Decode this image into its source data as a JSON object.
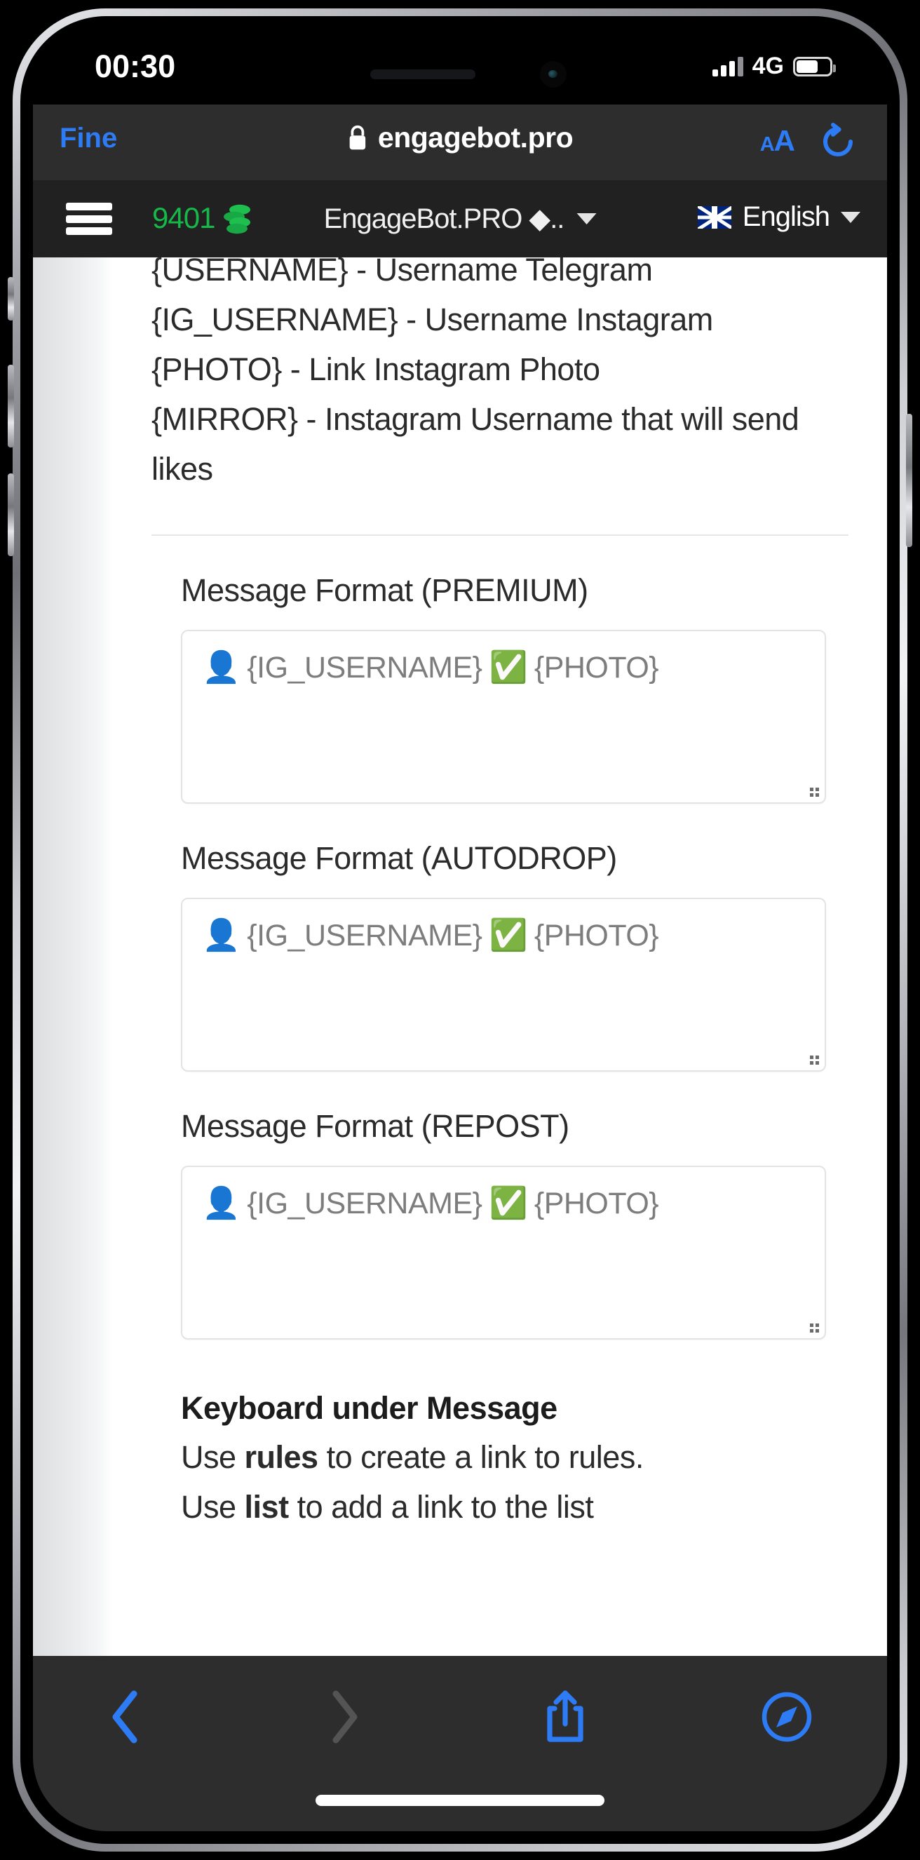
{
  "status_bar": {
    "time": "00:30",
    "network_type": "4G",
    "signal_icon": "signal-bars-icon",
    "battery_icon": "battery-icon",
    "battery_level_percent": 58,
    "signal_bars_filled": 3,
    "signal_bars_total": 4
  },
  "safari_top": {
    "back_to_app_label": "Fine",
    "lock_icon": "lock-icon",
    "url": "engagebot.pro",
    "text_size_label_small": "A",
    "text_size_label_large": "A",
    "reload_icon": "reload-icon"
  },
  "app_header": {
    "menu_icon": "hamburger-menu-icon",
    "balance": "9401",
    "coins_icon": "coins-icon",
    "bot_name": "EngageBot.PRO ◆..",
    "bot_dropdown_icon": "chevron-down-icon",
    "language_flag_icon": "uk-flag-icon",
    "language": "English",
    "language_dropdown_icon": "chevron-down-icon"
  },
  "content": {
    "variables": [
      "{USERNAME} - Username Telegram",
      "{IG_USERNAME} - Username Instagram",
      "{PHOTO} - Link Instagram Photo",
      "{MIRROR} - Instagram Username that will send likes"
    ],
    "fields": [
      {
        "label": "Message Format (PREMIUM)",
        "value_person_emoji": "👤",
        "value_part1": "{IG_USERNAME}",
        "value_check_emoji": "✅",
        "value_part2": "{PHOTO}",
        "resize_handle": "resize-grip-icon"
      },
      {
        "label": "Message Format (AUTODROP)",
        "value_person_emoji": "👤",
        "value_part1": "{IG_USERNAME}",
        "value_check_emoji": "✅",
        "value_part2": "{PHOTO}",
        "resize_handle": "resize-grip-icon"
      },
      {
        "label": "Message Format (REPOST)",
        "value_person_emoji": "👤",
        "value_part1": "{IG_USERNAME}",
        "value_check_emoji": "✅",
        "value_part2": "{PHOTO}",
        "resize_handle": "resize-grip-icon"
      }
    ],
    "keyboard_section": {
      "heading": "Keyboard under Message",
      "line1_prefix": "Use ",
      "line1_bold": "rules",
      "line1_suffix": " to create a link to rules.",
      "line2_prefix": "Use ",
      "line2_bold": "list",
      "line2_suffix": " to add a link to the list"
    }
  },
  "safari_bottom": {
    "back_icon": "chevron-left-icon",
    "forward_icon": "chevron-right-icon",
    "share_icon": "share-icon",
    "tabs_icon": "compass-icon"
  },
  "colors": {
    "accent_blue": "#2d7cf6",
    "balance_green": "#17b84a",
    "toolbar_bg": "#2d2d2d",
    "app_header_bg": "#212121",
    "page_bg": "#ffffff"
  }
}
